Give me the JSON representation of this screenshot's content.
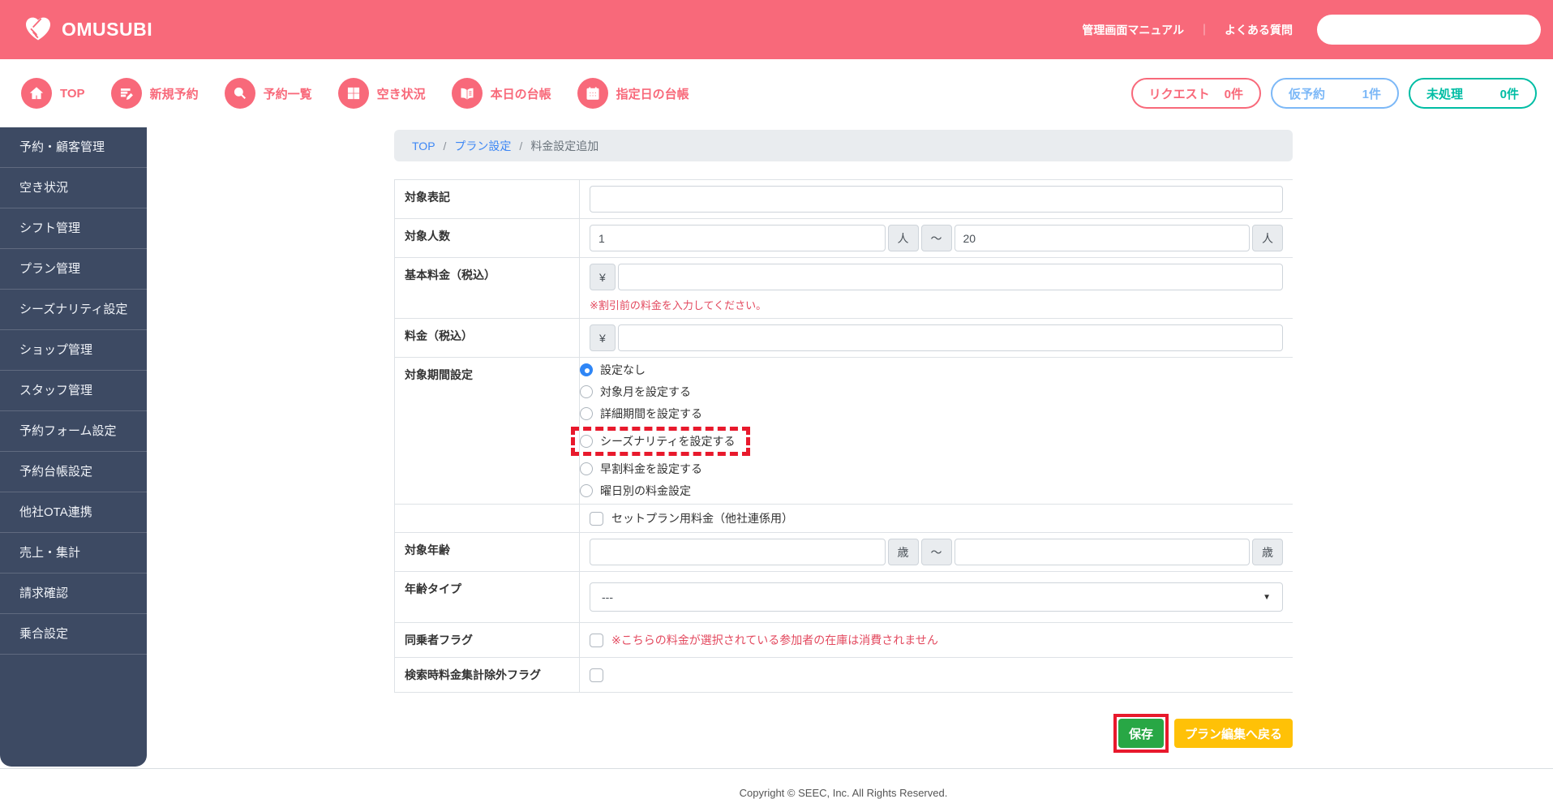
{
  "colors": {
    "brand_pink": "#f8697a",
    "sidebar_navy": "#3d4a63",
    "badge_blue": "#7cb8f7",
    "badge_teal": "#00bda4",
    "link_blue": "#3d87f5",
    "note_red": "#e34a5f",
    "save_green": "#28a745",
    "back_yellow": "#ffc107",
    "annotation_red": "#e8192c"
  },
  "header": {
    "logo_text": "OMUSUBI",
    "manual_link": "管理画面マニュアル",
    "divider": "｜",
    "faq_link": "よくある質問"
  },
  "nav": {
    "items": [
      {
        "label": "TOP",
        "icon": "home-icon"
      },
      {
        "label": "新規予約",
        "icon": "new-reservation-icon"
      },
      {
        "label": "予約一覧",
        "icon": "search-icon"
      },
      {
        "label": "空き状況",
        "icon": "grid-icon"
      },
      {
        "label": "本日の台帳",
        "icon": "book-icon"
      },
      {
        "label": "指定日の台帳",
        "icon": "calendar-icon"
      }
    ],
    "badges": [
      {
        "label": "リクエスト",
        "count": "0件"
      },
      {
        "label": "仮予約",
        "count": "1件"
      },
      {
        "label": "未処理",
        "count": "0件"
      }
    ]
  },
  "sidebar": {
    "items": [
      {
        "label": "予約・顧客管理"
      },
      {
        "label": "空き状況"
      },
      {
        "label": "シフト管理"
      },
      {
        "label": "プラン管理"
      },
      {
        "label": "シーズナリティ設定"
      },
      {
        "label": "ショップ管理"
      },
      {
        "label": "スタッフ管理"
      },
      {
        "label": "予約フォーム設定"
      },
      {
        "label": "予約台帳設定"
      },
      {
        "label": "他社OTA連携"
      },
      {
        "label": "売上・集計"
      },
      {
        "label": "請求確認"
      },
      {
        "label": "乗合設定"
      }
    ]
  },
  "breadcrumb": {
    "sep": "/",
    "items": [
      {
        "label": "TOP"
      },
      {
        "label": "プラン設定"
      },
      {
        "label": "料金設定追加"
      }
    ]
  },
  "form": {
    "target_notation": {
      "label": "対象表記",
      "value": ""
    },
    "target_people": {
      "label": "対象人数",
      "min": "1",
      "max": "20",
      "unit": "人",
      "tilde": "～"
    },
    "base_price": {
      "label": "基本料金（税込）",
      "currency": "¥",
      "value": "",
      "note": "※割引前の料金を入力してください。"
    },
    "price": {
      "label": "料金（税込）",
      "currency": "¥",
      "value": ""
    },
    "period": {
      "label": "対象期間設定",
      "selected_index": 0,
      "options": [
        {
          "label": "設定なし"
        },
        {
          "label": "対象月を設定する"
        },
        {
          "label": "詳細期間を設定する"
        },
        {
          "label": "シーズナリティを設定する"
        },
        {
          "label": "早割料金を設定する"
        },
        {
          "label": "曜日別の料金設定"
        }
      ]
    },
    "set_plan": {
      "label": "セットプラン用料金（他社連係用）"
    },
    "target_age": {
      "label": "対象年齢",
      "min": "",
      "max": "",
      "unit": "歳",
      "tilde": "～"
    },
    "age_type": {
      "label": "年齢タイプ",
      "value": "---"
    },
    "passenger_flag": {
      "label": "同乗者フラグ",
      "note": "※こちらの料金が選択されている参加者の在庫は消費されません"
    },
    "search_exclude_flag": {
      "label": "検索時料金集計除外フラグ"
    }
  },
  "buttons": {
    "save": "保存",
    "back": "プラン編集へ戻る"
  },
  "footer": {
    "copyright": "Copyright © SEEC, Inc. All Rights Reserved."
  }
}
